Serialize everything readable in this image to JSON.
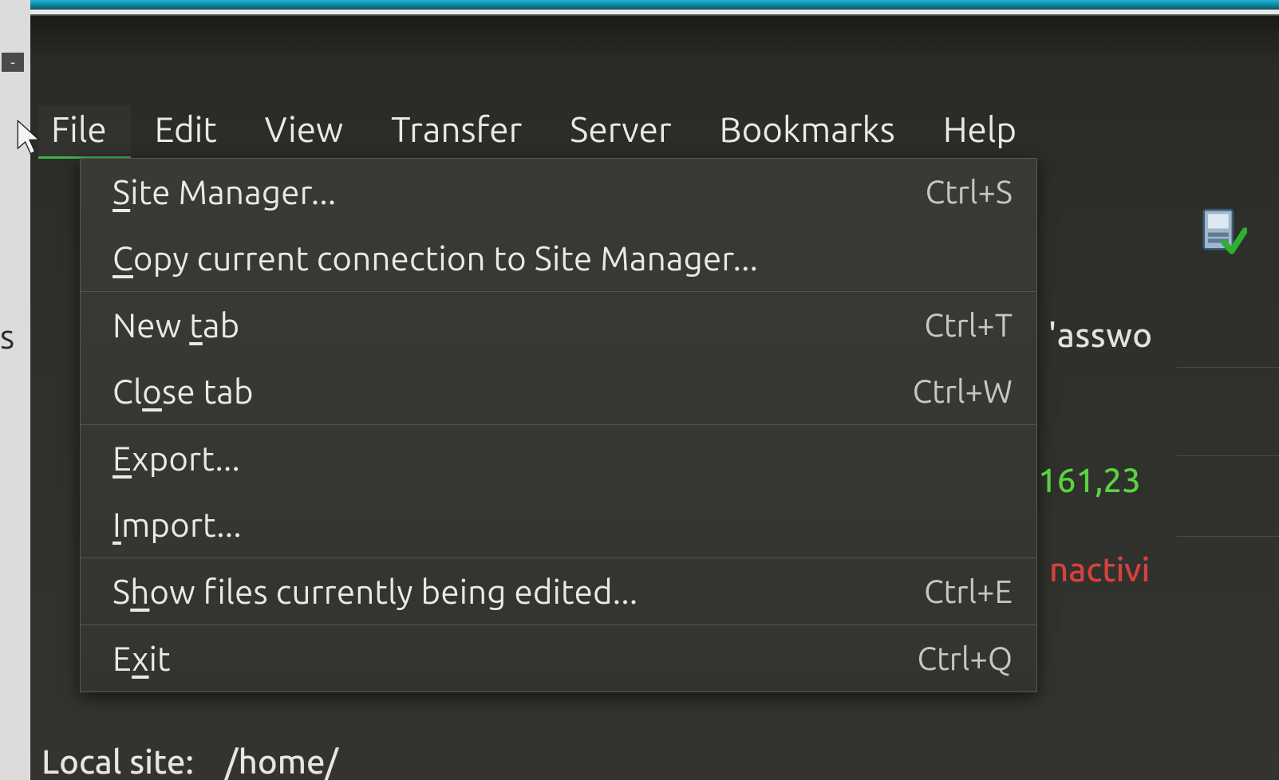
{
  "menubar": {
    "items": [
      {
        "label": "File"
      },
      {
        "label": "Edit"
      },
      {
        "label": "View"
      },
      {
        "label": "Transfer"
      },
      {
        "label": "Server"
      },
      {
        "label": "Bookmarks"
      },
      {
        "label": "Help"
      }
    ],
    "active": "File"
  },
  "file_menu": {
    "groups": [
      [
        {
          "label": "Site Manager...",
          "mnemonic_index": 0,
          "shortcut": "Ctrl+S"
        },
        {
          "label": "Copy current connection to Site Manager...",
          "mnemonic_index": 0,
          "shortcut": ""
        }
      ],
      [
        {
          "label": "New tab",
          "mnemonic_index": 4,
          "shortcut": "Ctrl+T"
        },
        {
          "label": "Close tab",
          "mnemonic_index": 2,
          "shortcut": "Ctrl+W"
        }
      ],
      [
        {
          "label": "Export...",
          "mnemonic_index": 0,
          "shortcut": ""
        },
        {
          "label": "Import...",
          "mnemonic_index": 0,
          "shortcut": ""
        }
      ],
      [
        {
          "label": "Show files currently being edited...",
          "mnemonic_index": 1,
          "shortcut": "Ctrl+E"
        }
      ],
      [
        {
          "label": "Exit",
          "mnemonic_index": 1,
          "shortcut": "Ctrl+Q"
        }
      ]
    ]
  },
  "background": {
    "password_fragment": "'asswo",
    "number_fragment": "161,23",
    "inactive_fragment": "nactivi",
    "bottom_fragment_left": "Local site:",
    "bottom_fragment_right": "/home/"
  },
  "icons": {
    "toolbar_server_icon": "server-check-icon"
  }
}
